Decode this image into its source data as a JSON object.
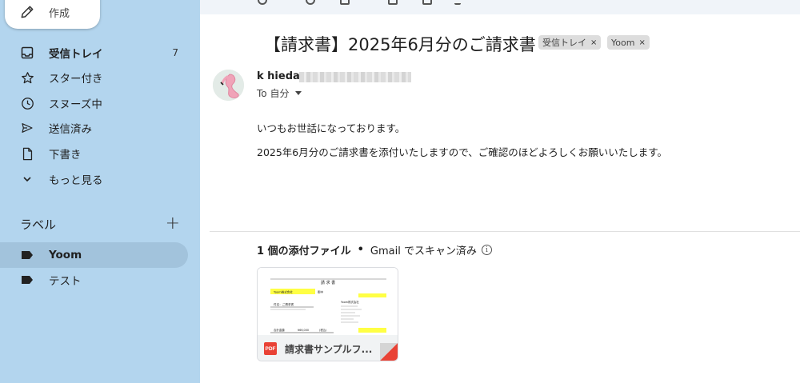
{
  "compose": {
    "label": "作成",
    "icon": "pencil-icon"
  },
  "nav": [
    {
      "label": "受信トレイ",
      "count": "7",
      "icon": "inbox-icon",
      "bold": true
    },
    {
      "label": "スター付き",
      "count": "",
      "icon": "star-icon"
    },
    {
      "label": "スヌーズ中",
      "count": "",
      "icon": "clock-icon"
    },
    {
      "label": "送信済み",
      "count": "",
      "icon": "send-icon"
    },
    {
      "label": "下書き",
      "count": "",
      "icon": "draft-icon"
    },
    {
      "label": "もっと見る",
      "count": "",
      "icon": "chevron-down-icon"
    }
  ],
  "labels": {
    "heading": "ラベル",
    "add": "+",
    "items": [
      {
        "label": "Yoom",
        "icon": "label-tag-icon",
        "active": true
      },
      {
        "label": "テスト",
        "icon": "label-tag-icon",
        "active": false
      }
    ]
  },
  "email": {
    "subject": "【請求書】2025年6月分のご請求書",
    "chips": [
      {
        "label": "受信トレイ",
        "close": "×"
      },
      {
        "label": "Yoom",
        "close": "×"
      }
    ],
    "sender_name": "k hieda",
    "to_line": "To 自分",
    "body": [
      "いつもお世話になっております。",
      "2025年6月分のご請求書を添付いたしますので、ご確認のほどよろしくお願いいたします。"
    ]
  },
  "attachments": {
    "count_label": "1 個の添付ファイル",
    "separator": "•",
    "scan_label": "Gmail でスキャン済み",
    "info_icon": "i",
    "file": {
      "badge": "PDF",
      "name": "請求書サンプルフ...",
      "preview": {
        "title": "請 求 書",
        "company": "Yoom株式会社",
        "honorific": "御中",
        "subject_label": "件名：ご請求書",
        "total_label": "合計金額",
        "total_value": "¥66,000",
        "tax_note": "(税込)",
        "sender_company": "Yoom株式会社"
      }
    }
  },
  "colors": {
    "sidebar": "#b3d5ee",
    "active_item": "#a2c3dc",
    "pdf": "#e94235"
  }
}
